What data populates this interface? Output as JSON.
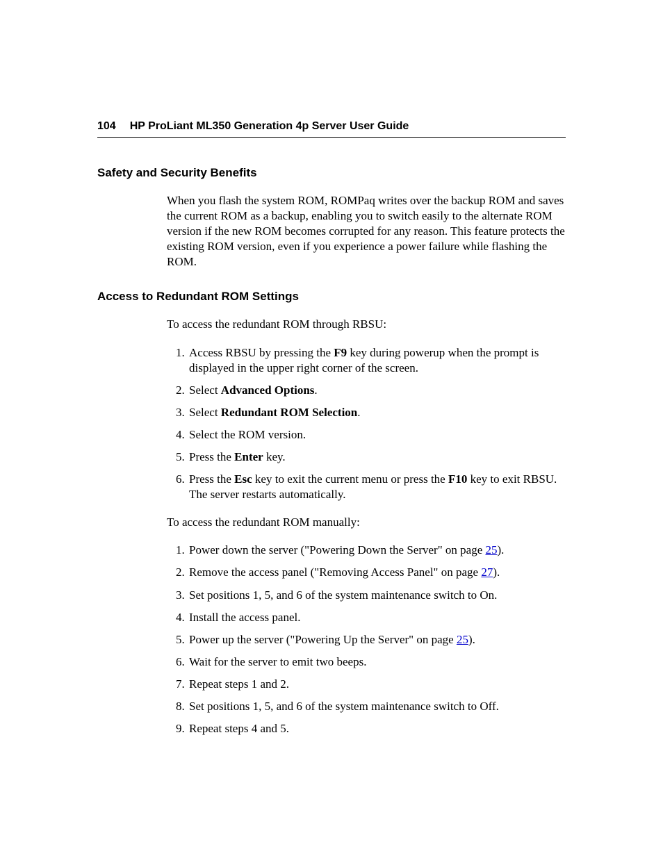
{
  "header": {
    "page_number": "104",
    "doc_title": "HP ProLiant ML350 Generation 4p Server User Guide"
  },
  "section1": {
    "heading": "Safety and Security Benefits",
    "paragraph": "When you flash the system ROM, ROMPaq writes over the backup ROM and saves the current ROM as a backup, enabling you to switch easily to the alternate ROM version if the new ROM becomes corrupted for any reason. This feature protects the existing ROM version, even if you experience a power failure while flashing the ROM."
  },
  "section2": {
    "heading": "Access to Redundant ROM Settings",
    "intro1": "To access the redundant ROM through RBSU:",
    "list1": {
      "i1_a": "Access RBSU by pressing the ",
      "i1_b": "F9",
      "i1_c": " key during powerup when the prompt is displayed in the upper right corner of the screen.",
      "i2_a": "Select ",
      "i2_b": "Advanced Options",
      "i2_c": ".",
      "i3_a": "Select ",
      "i3_b": "Redundant ROM Selection",
      "i3_c": ".",
      "i4": "Select the ROM version.",
      "i5_a": "Press the ",
      "i5_b": "Enter",
      "i5_c": " key.",
      "i6_a": "Press the ",
      "i6_b": "Esc",
      "i6_c": " key to exit the current menu or press the ",
      "i6_d": "F10",
      "i6_e": " key to exit RBSU. The server restarts automatically."
    },
    "intro2": "To access the redundant ROM manually:",
    "list2": {
      "i1_a": "Power down the server (\"Powering Down the Server\" on page ",
      "i1_link": "25",
      "i1_b": ").",
      "i2_a": "Remove the access panel (\"Removing Access Panel\" on page ",
      "i2_link": "27",
      "i2_b": ").",
      "i3": "Set positions 1, 5, and 6 of the system maintenance switch to On.",
      "i4": "Install the access panel.",
      "i5_a": "Power up the server (\"Powering Up the Server\" on page ",
      "i5_link": "25",
      "i5_b": ").",
      "i6": "Wait for the server to emit two beeps.",
      "i7": "Repeat steps 1 and 2.",
      "i8": "Set positions 1, 5, and 6 of the system maintenance switch to Off.",
      "i9": "Repeat steps 4 and 5."
    }
  }
}
